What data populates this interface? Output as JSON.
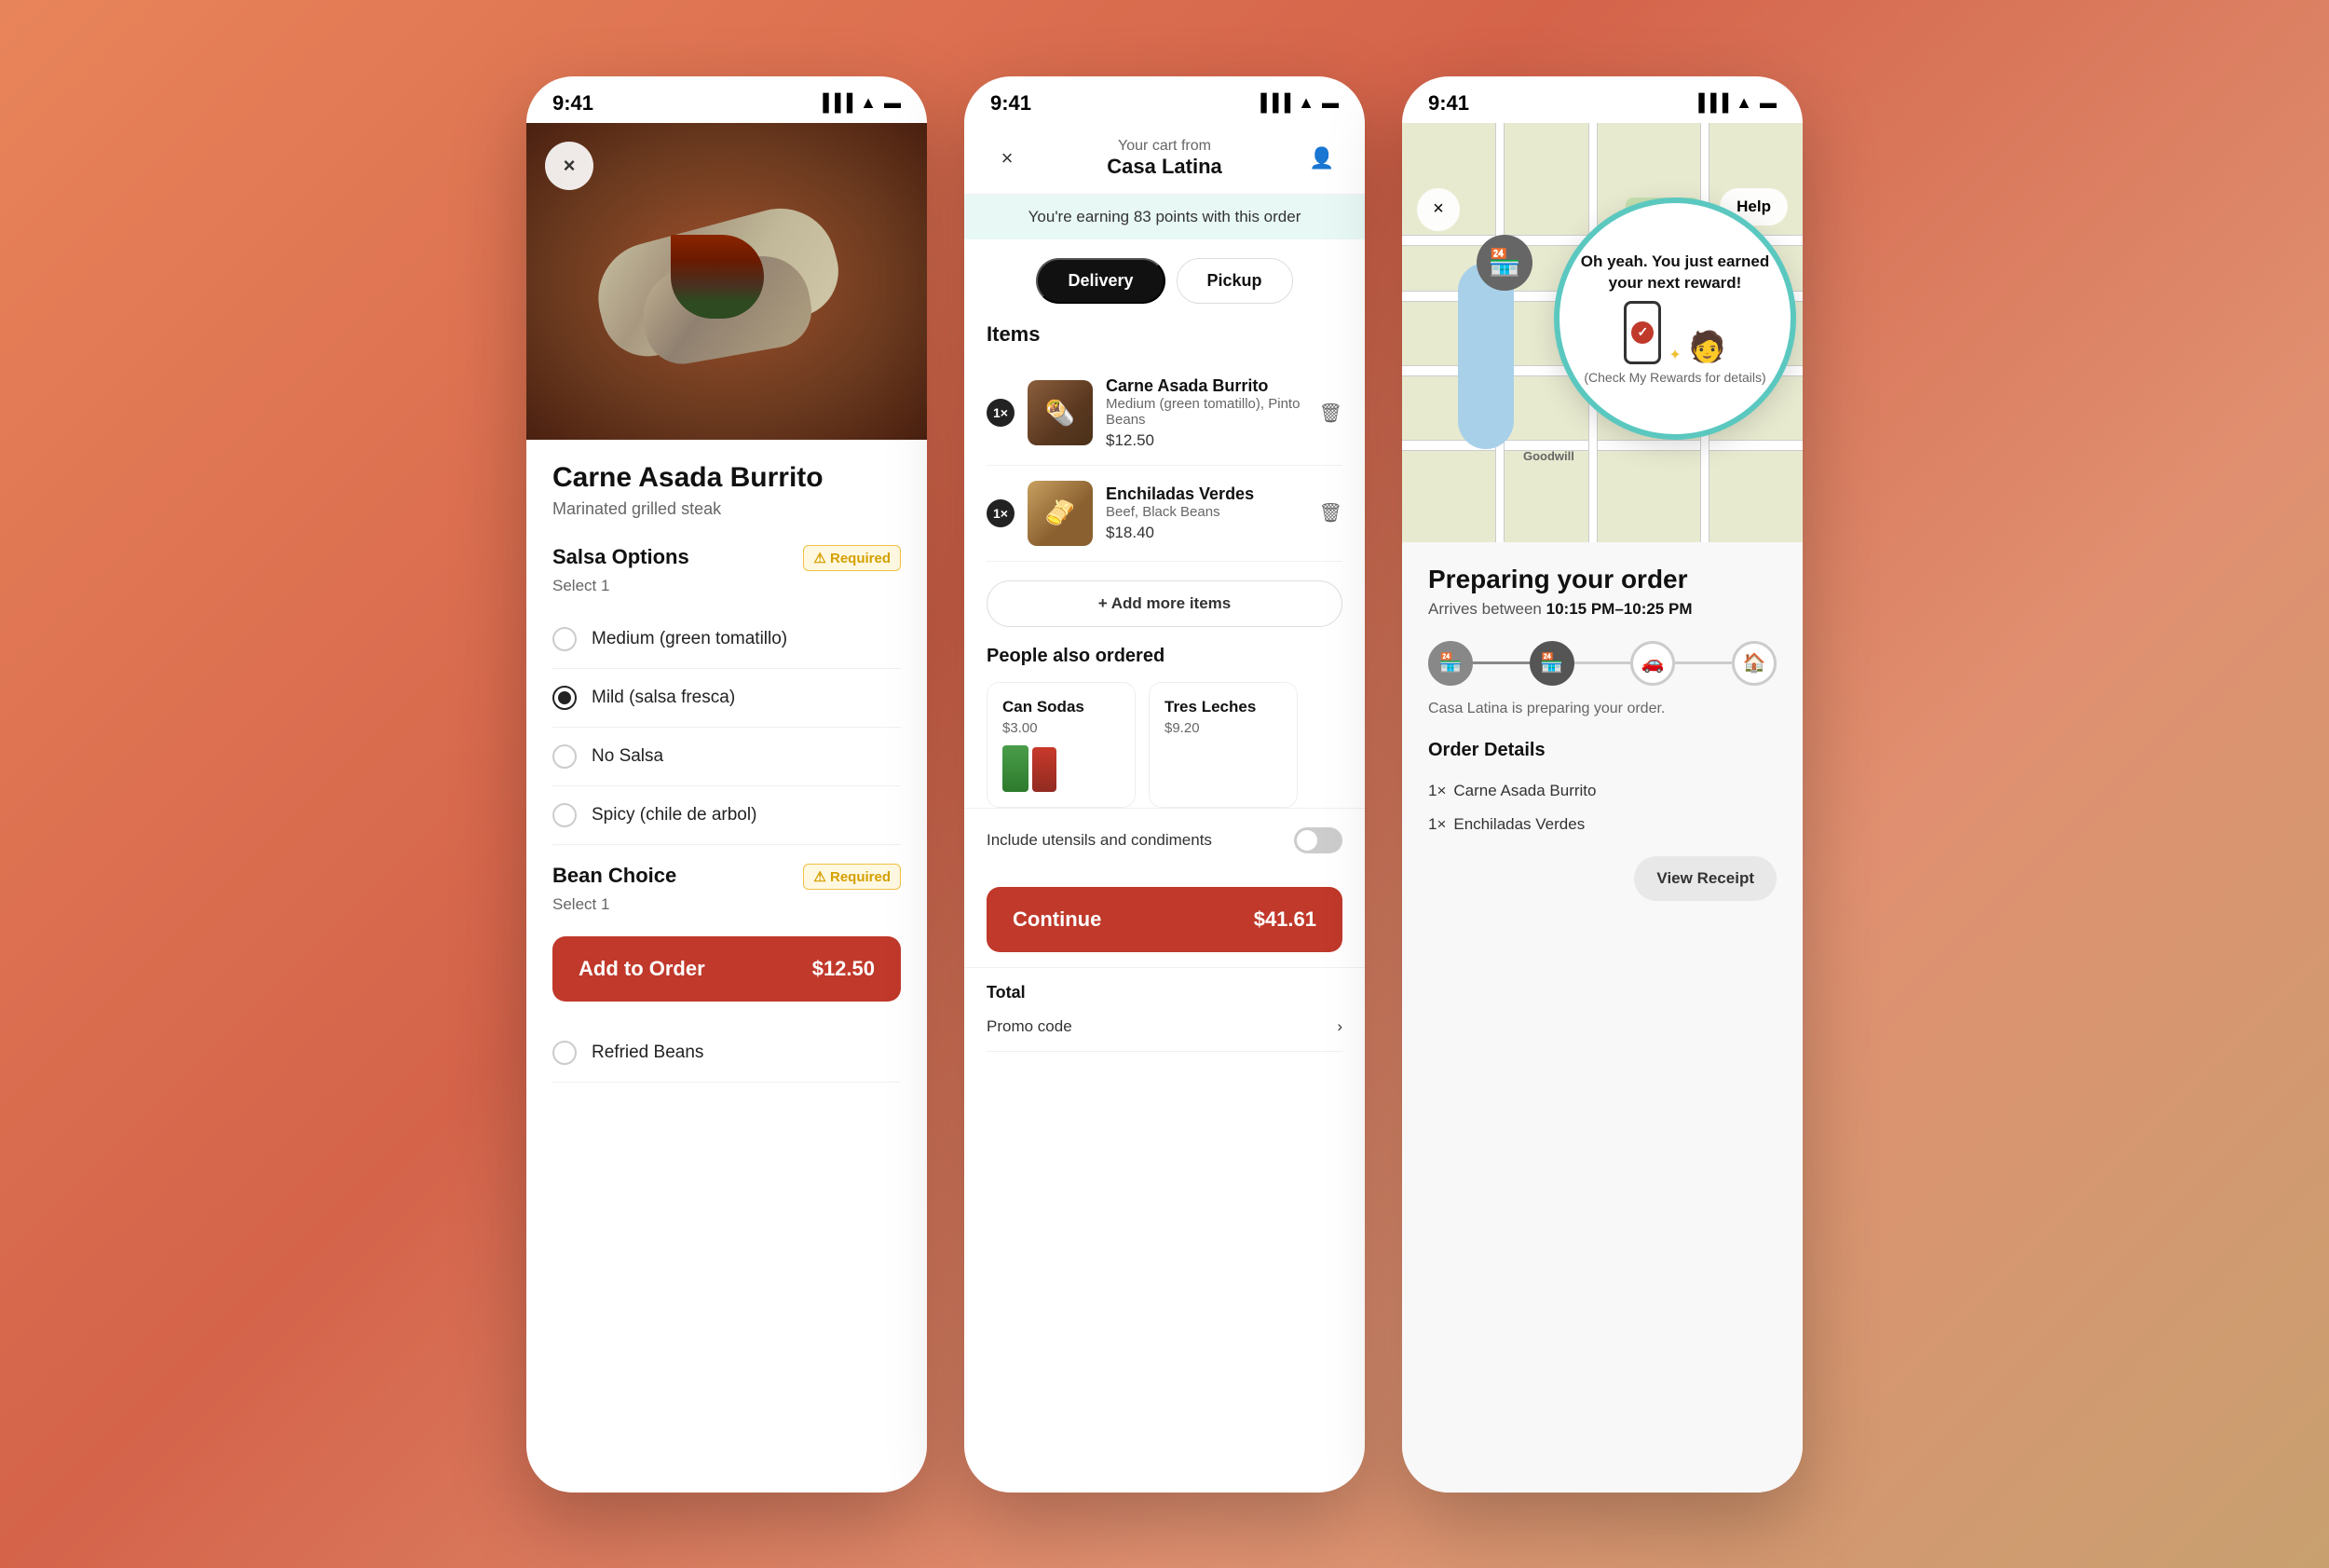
{
  "app": {
    "background": "#d9765a"
  },
  "phone1": {
    "status_time": "9:41",
    "close_label": "×",
    "item_name": "Carne Asada Burrito",
    "item_desc": "Marinated grilled steak",
    "salsa_section": {
      "title": "Salsa Options",
      "subtitle": "Select 1",
      "required_label": "⚠ Required",
      "options": [
        {
          "label": "Medium (green tomatillo)",
          "selected": false
        },
        {
          "label": "Mild (salsa fresca)",
          "selected": true
        },
        {
          "label": "No Salsa",
          "selected": false
        },
        {
          "label": "Spicy (chile de arbol)",
          "selected": false
        }
      ]
    },
    "bean_section": {
      "title": "Bean Choice",
      "subtitle": "Select 1",
      "required_label": "⚠ Required"
    },
    "add_btn_label": "Add to Order",
    "add_btn_price": "$12.50",
    "extra_option": "Refried Beans"
  },
  "phone2": {
    "status_time": "9:41",
    "close_icon": "×",
    "profile_icon": "👤",
    "cart_subtitle": "Your cart from",
    "cart_title": "Casa Latina",
    "points_text": "You're earning 83 points with this order",
    "tabs": [
      {
        "label": "Delivery",
        "active": true
      },
      {
        "label": "Pickup",
        "active": false
      }
    ],
    "items_label": "Items",
    "cart_items": [
      {
        "qty": "1×",
        "name": "Carne Asada Burrito",
        "desc": "Medium (green tomatillo), Pinto Beans",
        "price": "$12.50"
      },
      {
        "qty": "1×",
        "name": "Enchiladas Verdes",
        "desc": "Beef, Black Beans",
        "price": "$18.40"
      }
    ],
    "add_more_label": "+ Add more items",
    "people_label": "People also ordered",
    "people_items": [
      {
        "name": "Can Sodas",
        "price": "$3.00"
      },
      {
        "name": "Tres Leches",
        "price": "$9.20"
      }
    ],
    "utensils_label": "Include utensils and condiments",
    "total_label": "Total",
    "promo_label": "Promo code",
    "continue_label": "Continue",
    "continue_price": "$41.61"
  },
  "phone3": {
    "status_time": "9:41",
    "close_icon": "×",
    "help_label": "Help",
    "reward_title": "Oh yeah. You just earned your next reward!",
    "reward_sub": "(Check My Rewards for details)",
    "preparing_title": "Preparing your order",
    "preparing_sub_prefix": "Arrives between ",
    "arrives_time": "10:15 PM–10:25 PM",
    "progress_status": "Casa Latina is preparing your order.",
    "order_details_title": "Order Details",
    "order_items": [
      {
        "qty": "1×",
        "name": "Carne Asada Burrito"
      },
      {
        "qty": "1×",
        "name": "Enchiladas Verdes"
      }
    ],
    "view_receipt_label": "View Receipt"
  }
}
